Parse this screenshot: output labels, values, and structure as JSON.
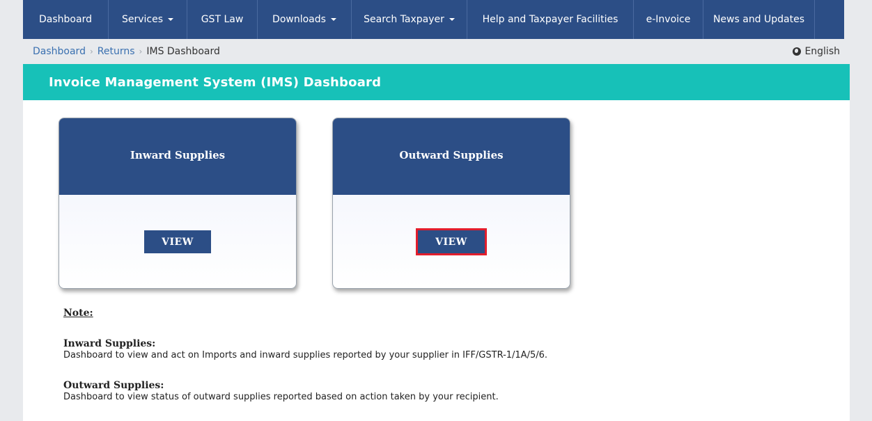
{
  "nav": {
    "items": [
      {
        "label": "Dashboard",
        "dropdown": false
      },
      {
        "label": "Services",
        "dropdown": true
      },
      {
        "label": "GST Law",
        "dropdown": false
      },
      {
        "label": "Downloads",
        "dropdown": true
      },
      {
        "label": "Search Taxpayer",
        "dropdown": true
      },
      {
        "label": "Help and Taxpayer Facilities",
        "dropdown": false
      },
      {
        "label": "e-Invoice",
        "dropdown": false
      },
      {
        "label": "News and Updates",
        "dropdown": false
      }
    ]
  },
  "breadcrumb": {
    "items": [
      "Dashboard",
      "Returns"
    ],
    "current": "IMS Dashboard"
  },
  "language": {
    "label": "English",
    "icon": "globe-icon"
  },
  "panel": {
    "title": "Invoice Management System (IMS) Dashboard"
  },
  "cards": [
    {
      "title": "Inward Supplies",
      "button": "VIEW"
    },
    {
      "title": "Outward Supplies",
      "button": "VIEW"
    }
  ],
  "notes": {
    "title": "Note:",
    "items": [
      {
        "heading": "Inward Supplies:",
        "text": "Dashboard to view and act on Imports and inward supplies reported by your supplier in IFF/GSTR-1/1A/5/6."
      },
      {
        "heading": "Outward Supplies:",
        "text": "Dashboard to view status of outward supplies reported based on action taken by your recipient."
      }
    ]
  },
  "colors": {
    "nav_bg": "#2c4e86",
    "header_teal": "#17c1b8",
    "highlight_red": "#e21d2c"
  }
}
